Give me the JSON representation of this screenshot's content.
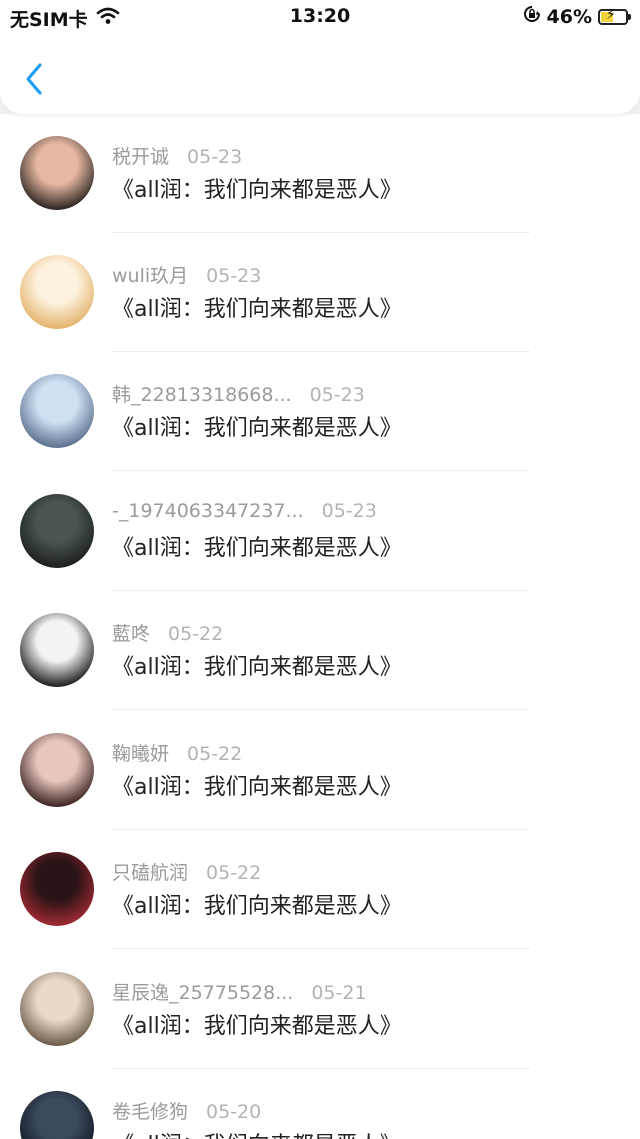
{
  "status_bar": {
    "carrier": "无SIM卡",
    "time": "13:20",
    "battery": "46%"
  },
  "items": [
    {
      "name": "税开诚",
      "date": "05-23",
      "text": "《all润：我们向来都是恶人》",
      "avatar_colors": [
        "#e8b9a2",
        "#2b2320"
      ]
    },
    {
      "name": "wuli玖月",
      "date": "05-23",
      "text": "《all润：我们向来都是恶人》",
      "avatar_colors": [
        "#fdf2df",
        "#e3b26a"
      ]
    },
    {
      "name": "韩_22813318668...",
      "date": "05-23",
      "text": "《all润：我们向来都是恶人》",
      "avatar_colors": [
        "#cfe0f2",
        "#5b6f8e"
      ]
    },
    {
      "name": "-_1974063347237...",
      "date": "05-23",
      "text": "《all润：我们向来都是恶人》",
      "avatar_colors": [
        "#4a5450",
        "#1a1f1d"
      ]
    },
    {
      "name": "藍咚",
      "date": "05-22",
      "text": "《all润：我们向来都是恶人》",
      "avatar_colors": [
        "#f3f3f3",
        "#1c1c1c"
      ]
    },
    {
      "name": "鞠曦妍",
      "date": "05-22",
      "text": "《all润：我们向来都是恶人》",
      "avatar_colors": [
        "#e6c6bf",
        "#3a2320"
      ]
    },
    {
      "name": "只磕航润",
      "date": "05-22",
      "text": "《all润：我们向来都是恶人》",
      "avatar_colors": [
        "#2a1416",
        "#a12a33"
      ]
    },
    {
      "name": "星辰逸_25775528...",
      "date": "05-21",
      "text": "《all润：我们向来都是恶人》",
      "avatar_colors": [
        "#e9d9c7",
        "#6b5a4a"
      ]
    },
    {
      "name": "卷毛修狗",
      "date": "05-20",
      "text": "《all润：我们向来都是恶人》",
      "avatar_colors": [
        "#3c4a5e",
        "#0f1620"
      ]
    }
  ]
}
